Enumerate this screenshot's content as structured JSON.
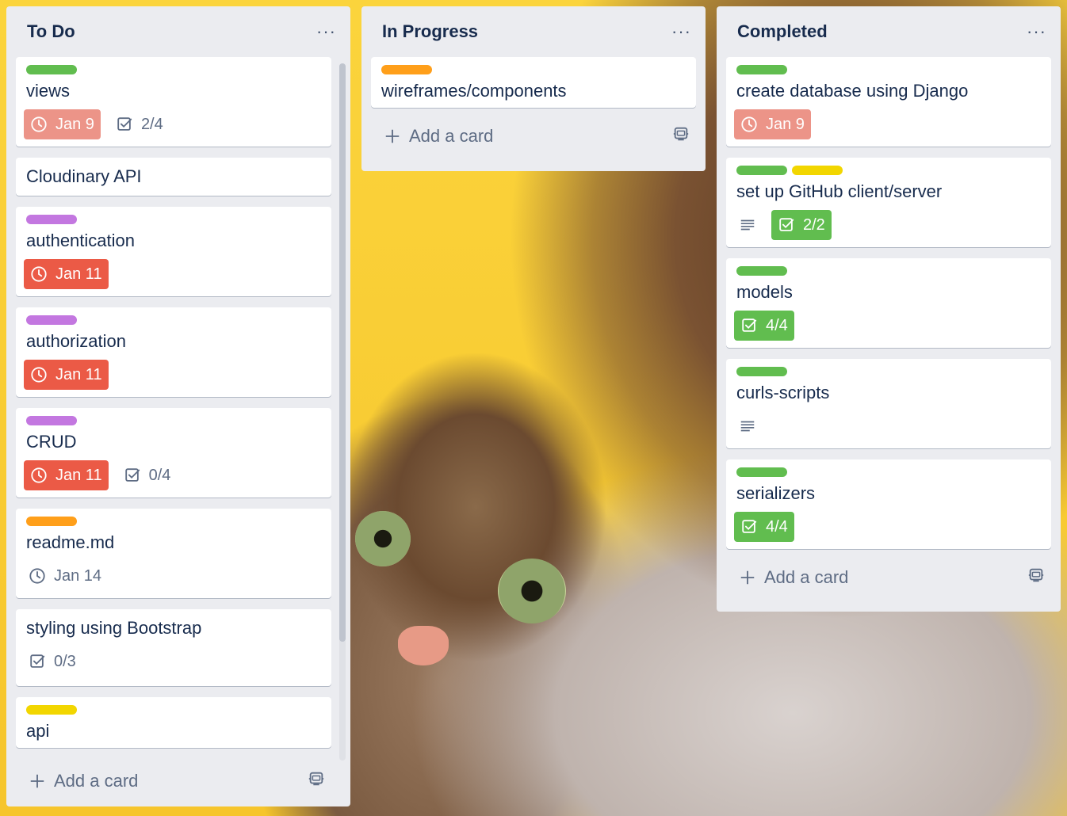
{
  "colors": {
    "green": "#61bd4f",
    "yellow": "#f2d600",
    "orange": "#ff9f1a",
    "purple": "#c377e0",
    "red": "#eb5a46",
    "pink": "#ec9488"
  },
  "icons": {
    "more": "more-horizontal-icon",
    "clock": "clock-icon",
    "checklist": "checklist-icon",
    "description": "description-icon",
    "plus": "plus-icon",
    "template": "card-template-icon"
  },
  "lists": [
    {
      "title": "To Do",
      "more": "···",
      "add_card": "Add a card",
      "cards": [
        {
          "title": "views",
          "labels": [
            "green"
          ],
          "due": {
            "text": "Jan 9",
            "state": "due-past"
          },
          "checklist": {
            "text": "2/4",
            "complete": false
          }
        },
        {
          "title": "Cloudinary API",
          "labels": []
        },
        {
          "title": "authentication",
          "labels": [
            "purple"
          ],
          "due": {
            "text": "Jan 11",
            "state": "due-overdue"
          }
        },
        {
          "title": "authorization",
          "labels": [
            "purple"
          ],
          "due": {
            "text": "Jan 11",
            "state": "due-overdue"
          }
        },
        {
          "title": "CRUD",
          "labels": [
            "purple"
          ],
          "due": {
            "text": "Jan 11",
            "state": "due-overdue"
          },
          "checklist": {
            "text": "0/4",
            "complete": false
          }
        },
        {
          "title": "readme.md",
          "labels": [
            "orange"
          ],
          "due": {
            "text": "Jan 14",
            "state": "plain"
          }
        },
        {
          "title": "styling using Bootstrap",
          "labels": [],
          "checklist": {
            "text": "0/3",
            "complete": false
          }
        },
        {
          "title": "api",
          "labels": [
            "yellow"
          ]
        }
      ]
    },
    {
      "title": "In Progress",
      "more": "···",
      "add_card": "Add a card",
      "cards": [
        {
          "title": "wireframes/components",
          "labels": [
            "orange"
          ]
        }
      ]
    },
    {
      "title": "Completed",
      "more": "···",
      "add_card": "Add a card",
      "cards": [
        {
          "title": "create database using Django",
          "labels": [
            "green"
          ],
          "due": {
            "text": "Jan 9",
            "state": "due-past"
          }
        },
        {
          "title": "set up GitHub client/server",
          "labels": [
            "green",
            "yellow"
          ],
          "description": true,
          "checklist": {
            "text": "2/2",
            "complete": true
          }
        },
        {
          "title": "models",
          "labels": [
            "green"
          ],
          "checklist": {
            "text": "4/4",
            "complete": true
          }
        },
        {
          "title": "curls-scripts",
          "labels": [
            "green"
          ],
          "description": true
        },
        {
          "title": "serializers",
          "labels": [
            "green"
          ],
          "checklist": {
            "text": "4/4",
            "complete": true
          }
        }
      ]
    }
  ]
}
